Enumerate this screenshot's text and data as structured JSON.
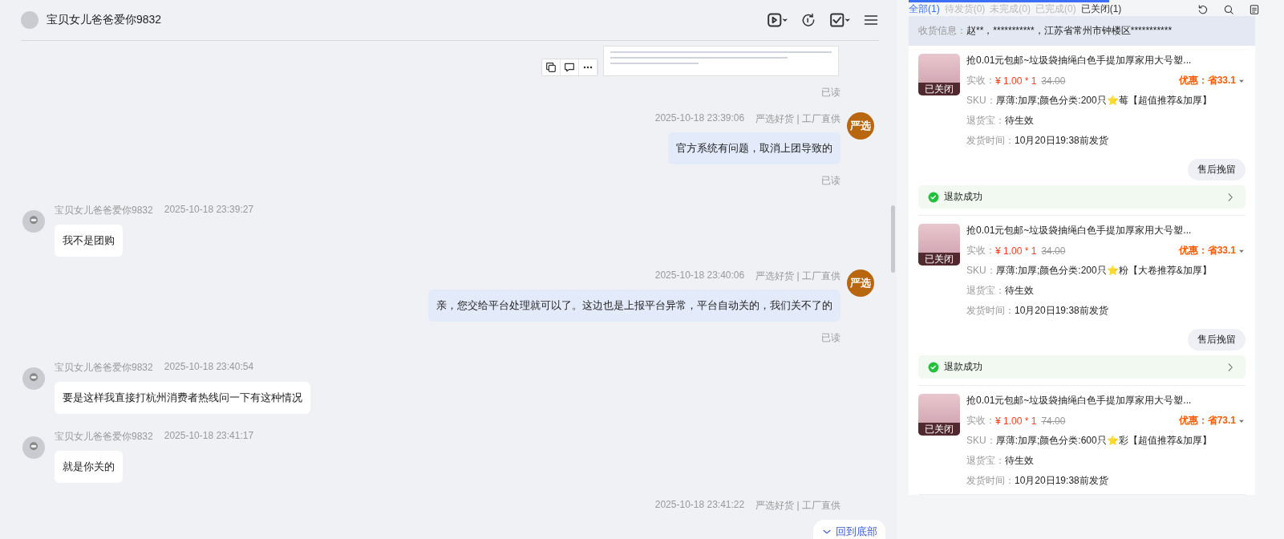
{
  "chat": {
    "title": "宝贝女儿爸爸爱你9832",
    "messages": [
      {
        "kind": "image",
        "read": "已读"
      },
      {
        "kind": "out",
        "time": "2025-10-18 23:39:06",
        "shop_tag": "严选好货 | 工厂直供",
        "avatar_text": "严选",
        "text": "官方系统有问题，取消上团导致的",
        "read": "已读"
      },
      {
        "kind": "in",
        "sender": "宝贝女儿爸爸爱你9832",
        "time": "2025-10-18 23:39:27",
        "text": "我不是团购"
      },
      {
        "kind": "out",
        "time": "2025-10-18 23:40:06",
        "shop_tag": "严选好货 | 工厂直供",
        "avatar_text": "严选",
        "text": "亲，您交给平台处理就可以了。这边也是上报平台异常，平台自动关的，我们关不了的",
        "read": "已读"
      },
      {
        "kind": "in",
        "sender": "宝贝女儿爸爸爱你9832",
        "time": "2025-10-18 23:40:54",
        "text": "要是这样我直接打杭州消费者热线问一下有这种情况"
      },
      {
        "kind": "in",
        "sender": "宝贝女儿爸爸爱你9832",
        "time": "2025-10-18 23:41:17",
        "text": "就是你关的"
      },
      {
        "kind": "out_partial",
        "time": "2025-10-18 23:41:22",
        "shop_tag": "严选好货 | 工厂直供"
      }
    ],
    "jump_button": "回到底部"
  },
  "orders_panel": {
    "tabs": [
      {
        "label": "全部(1)",
        "selected": true,
        "disabled": false
      },
      {
        "label": "待发货(0)",
        "selected": false,
        "disabled": true
      },
      {
        "label": "未完成(0)",
        "selected": false,
        "disabled": true
      },
      {
        "label": "已完成(0)",
        "selected": false,
        "disabled": true
      },
      {
        "label": "已关闭(1)",
        "selected": false,
        "disabled": false
      }
    ],
    "address_label": "收货信息：",
    "address": "赵**，***********，江苏省常州市钟楼区***********",
    "orders": [
      {
        "status": "已关闭",
        "title": "抢0.01元包邮~垃圾袋抽绳白色手提加厚家用大号塑...",
        "paid_label": "实收：",
        "paid": "¥ 1.00 * 1",
        "original": "34.00",
        "discount": "优惠：省33.1",
        "sku_label": "SKU：",
        "sku": "厚薄:加厚;颜色分类:200只⭐莓【超值推荐&加厚】",
        "return_label": "退货宝：",
        "return": "待生效",
        "ship_label": "发货时间：",
        "ship": "10月20日19:38前发货",
        "action": "售后挽留",
        "refund": "退款成功"
      },
      {
        "status": "已关闭",
        "title": "抢0.01元包邮~垃圾袋抽绳白色手提加厚家用大号塑...",
        "paid_label": "实收：",
        "paid": "¥ 1.00 * 1",
        "original": "34.00",
        "discount": "优惠：省33.1",
        "sku_label": "SKU：",
        "sku": "厚薄:加厚;颜色分类:200只⭐粉【大卷推荐&加厚】",
        "return_label": "退货宝：",
        "return": "待生效",
        "ship_label": "发货时间：",
        "ship": "10月20日19:38前发货",
        "action": "售后挽留",
        "refund": "退款成功"
      },
      {
        "status": "已关闭",
        "title": "抢0.01元包邮~垃圾袋抽绳白色手提加厚家用大号塑...",
        "paid_label": "实收：",
        "paid": "¥ 1.00 * 1",
        "original": "74.00",
        "discount": "优惠：省73.1",
        "sku_label": "SKU：",
        "sku": "厚薄:加厚;颜色分类:600只⭐彩【超值推荐&加厚】",
        "return_label": "退货宝：",
        "return": "待生效",
        "ship_label": "发货时间：",
        "ship": "10月20日19:38前发货"
      }
    ]
  }
}
